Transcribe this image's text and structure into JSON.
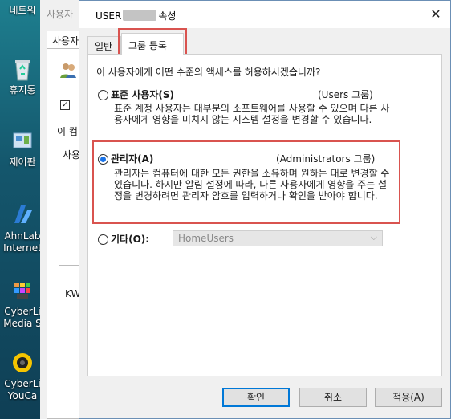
{
  "desktop": {
    "icons": [
      {
        "label": "네트워",
        "icon": "network-icon"
      },
      {
        "label": "휴지통",
        "icon": "recycle-bin-icon"
      },
      {
        "label": "제어판",
        "icon": "control-panel-icon"
      },
      {
        "label": "AhnLab Internet",
        "icon": "ahnlab-icon"
      },
      {
        "label": "CyberLi Media S",
        "icon": "cyberlink-media-icon"
      },
      {
        "label": "CyberLi YouCa",
        "icon": "youcam-icon"
      }
    ]
  },
  "bg_window": {
    "title": "사용자",
    "tab": "사용자",
    "panel_text_1": "이 컴",
    "panel_text_2": "사용",
    "panel_text_3": "KW"
  },
  "dialog": {
    "title_prefix": "USER",
    "title_suffix": "속성",
    "close": "✕",
    "tabs": [
      "일반",
      "그룹 등록"
    ],
    "question": "이 사용자에게 어떤 수준의 액세스를 허용하시겠습니까?",
    "options": [
      {
        "label": "표준 사용자(S)",
        "group": "(Users 그룹)",
        "desc": "표준 계정 사용자는 대부분의 소프트웨어를 사용할 수 있으며 다른 사용자에게 영향을 미치지 않는 시스템 설정을 변경할 수 있습니다.",
        "checked": false
      },
      {
        "label": "관리자(A)",
        "group": "(Administrators 그룹)",
        "desc": "관리자는 컴퓨터에 대한 모든 권한을 소유하며 원하는 대로 변경할 수 있습니다. 하지만 알림 설정에 따라, 다른 사용자에게 영향을 주는 설정을 변경하려면 관리자 암호를 입력하거나 확인을 받아야 합니다.",
        "checked": true
      },
      {
        "label": "기타(O):",
        "checked": false
      }
    ],
    "other_select_value": "HomeUsers",
    "buttons": {
      "ok": "확인",
      "cancel": "취소",
      "apply": "적용(A)"
    },
    "accent_color": "#0078d7",
    "highlight_color": "#d9534f"
  }
}
